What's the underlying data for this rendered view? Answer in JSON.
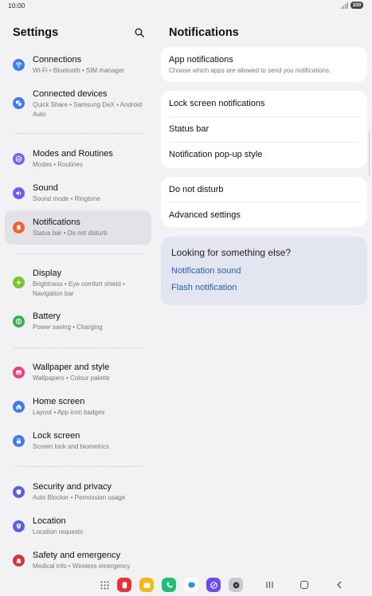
{
  "status": {
    "time": "10:00",
    "battery": "100"
  },
  "left": {
    "title": "Settings",
    "items": [
      {
        "label": "Connections",
        "sub": "Wi-Fi  •  Bluetooth  •  SIM manager",
        "icon": "wifi-icon",
        "color": "#3d7bf5"
      },
      {
        "label": "Connected devices",
        "sub": "Quick Share  •  Samsung DeX  •  Android Auto",
        "icon": "connected-devices-icon",
        "color": "#3d7bf5"
      },
      {
        "label": "Modes and Routines",
        "sub": "Modes  •  Routines",
        "icon": "check-circle-icon",
        "color": "#7e5ef2"
      },
      {
        "label": "Sound",
        "sub": "Sound mode  •  Ringtone",
        "icon": "speaker-icon",
        "color": "#6f5cf0"
      },
      {
        "label": "Notifications",
        "sub": "Status bar  •  Do not disturb",
        "icon": "bell-icon",
        "color": "#f0612d"
      },
      {
        "label": "Display",
        "sub": "Brightness  •  Eye comfort shield  •  Navigation bar",
        "icon": "sun-icon",
        "color": "#7cc42b"
      },
      {
        "label": "Battery",
        "sub": "Power saving  •  Charging",
        "icon": "battery-icon",
        "color": "#35b04d"
      },
      {
        "label": "Wallpaper and style",
        "sub": "Wallpapers  •  Colour palette",
        "icon": "image-icon",
        "color": "#e8437a"
      },
      {
        "label": "Home screen",
        "sub": "Layout  •  App icon badges",
        "icon": "home-icon",
        "color": "#3d7bf5"
      },
      {
        "label": "Lock screen",
        "sub": "Screen lock and biometrics",
        "icon": "lock-icon",
        "color": "#3d7bf5"
      },
      {
        "label": "Security and privacy",
        "sub": "Auto Blocker  •  Permission usage",
        "icon": "shield-icon",
        "color": "#5b5fe6"
      },
      {
        "label": "Location",
        "sub": "Location requests",
        "icon": "location-pin-icon",
        "color": "#5b5fe6"
      },
      {
        "label": "Safety and emergency",
        "sub": "Medical info  •  Wireless emergency",
        "icon": "emergency-icon",
        "color": "#d8343e"
      }
    ]
  },
  "right": {
    "title": "Notifications",
    "app_notifications": {
      "label": "App notifications",
      "sub": "Choose which apps are allowed to send you notifications."
    },
    "group2": [
      "Lock screen notifications",
      "Status bar",
      "Notification pop-up style"
    ],
    "group3": [
      "Do not disturb",
      "Advanced settings"
    ],
    "suggest": {
      "heading": "Looking for something else?",
      "links": [
        "Notification sound",
        "Flash notification"
      ]
    }
  },
  "dock": {
    "apps": [
      {
        "name": "notes-app-icon",
        "color": "#e8323b"
      },
      {
        "name": "folder-app-icon",
        "color": "#f5b81c"
      },
      {
        "name": "phone-app-icon",
        "color": "#1fbf73"
      },
      {
        "name": "messages-app-icon",
        "color": "#2f8cf5"
      },
      {
        "name": "internet-app-icon",
        "color": "#6a4cf0"
      },
      {
        "name": "camera-app-icon",
        "color": "#c9c9cd"
      }
    ]
  }
}
